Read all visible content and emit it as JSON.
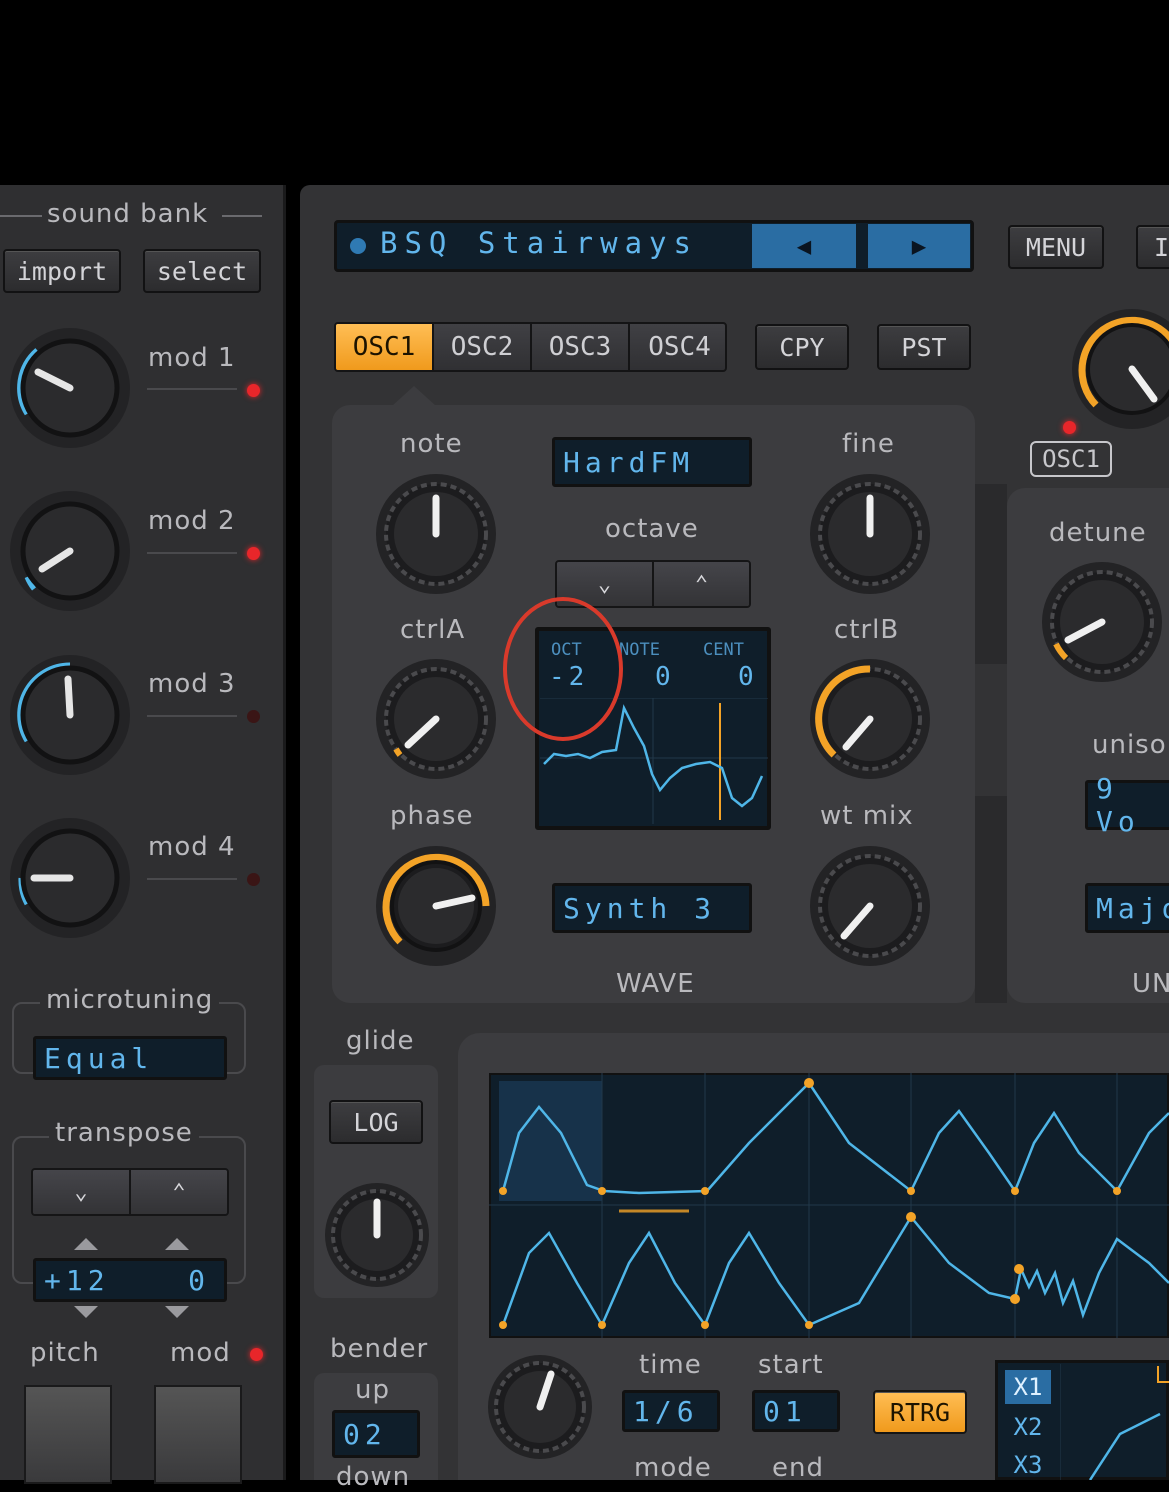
{
  "left": {
    "sound_bank_title": "sound bank",
    "import_label": "import",
    "select_label": "select",
    "mods": [
      {
        "label": "mod 1",
        "led_on": true
      },
      {
        "label": "mod 2",
        "led_on": true
      },
      {
        "label": "mod 3",
        "led_on": false
      },
      {
        "label": "mod 4",
        "led_on": false
      }
    ],
    "microtuning_title": "microtuning",
    "microtuning_value": "Equal",
    "transpose_title": "transpose",
    "transpose_down": "⌄",
    "transpose_up": "⌃",
    "transpose_semis": "+12",
    "transpose_cents": "0",
    "pitch_label": "pitch",
    "mod_label": "mod"
  },
  "header": {
    "preset_name": "BSQ Stairways",
    "prev_arrow": "◀",
    "next_arrow": "▶",
    "menu_label": "MENU",
    "cut_label": "I"
  },
  "osc": {
    "tabs": [
      "OSC1",
      "OSC2",
      "OSC3",
      "OSC4"
    ],
    "active_tab": 0,
    "copy_label": "CPY",
    "paste_label": "PST",
    "note_label": "note",
    "fine_label": "fine",
    "ctrlA_label": "ctrlA",
    "ctrlB_label": "ctrlB",
    "phase_label": "phase",
    "wtmix_label": "wt mix",
    "wave_mode": "HardFM",
    "octave_label": "octave",
    "octave_down": "⌄",
    "octave_up": "⌃",
    "display": {
      "oct_label": "OCT",
      "note_label": "NOTE",
      "cent_label": "CENT",
      "oct_value": "-2",
      "note_value": "0",
      "cent_value": "0"
    },
    "wave_name": "Synth 3",
    "wave_footer": "WAVE"
  },
  "right": {
    "osc_target": "OSC1",
    "detune_label": "detune",
    "unison_label": "uniso",
    "voices_value": "9 Vo",
    "chord_value": "Majo",
    "footer": "UN"
  },
  "glide": {
    "label": "glide",
    "mode": "LOG"
  },
  "bender": {
    "label": "bender",
    "up_label": "up",
    "up_value": "02",
    "down_label": "down"
  },
  "lfo": {
    "time_label": "time",
    "time_value": "1/6",
    "start_label": "start",
    "start_value": "01",
    "retrig_label": "RTRG",
    "mode_label": "mode",
    "end_label": "end",
    "multipliers": [
      "X1",
      "X2",
      "X3"
    ]
  },
  "colors": {
    "accent_orange": "#f3a327",
    "lcd_blue": "#62b6ec",
    "ring_blue": "#4fb6e8",
    "led_red": "#e8262a"
  }
}
